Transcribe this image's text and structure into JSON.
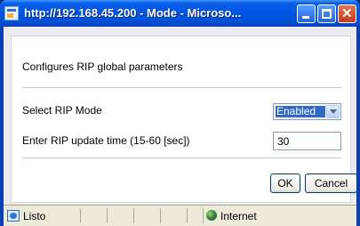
{
  "window": {
    "title": "http://192.168.45.200 - Mode - Microso...",
    "controls": {
      "minimize": "minimize",
      "maximize": "maximize",
      "close": "✕"
    }
  },
  "form": {
    "heading": "Configures RIP global parameters",
    "mode_label": "Select RIP Mode",
    "mode_value": "Enabled",
    "time_label": "Enter RIP update time (15-60 [sec])",
    "time_value": "30"
  },
  "buttons": {
    "ok": "OK",
    "cancel": "Cancel"
  },
  "statusbar": {
    "status": "Listo",
    "zone": "Internet"
  },
  "colors": {
    "titlebar": "#0054e3",
    "selected": "#316ac5",
    "background": "#ebeaf0"
  }
}
